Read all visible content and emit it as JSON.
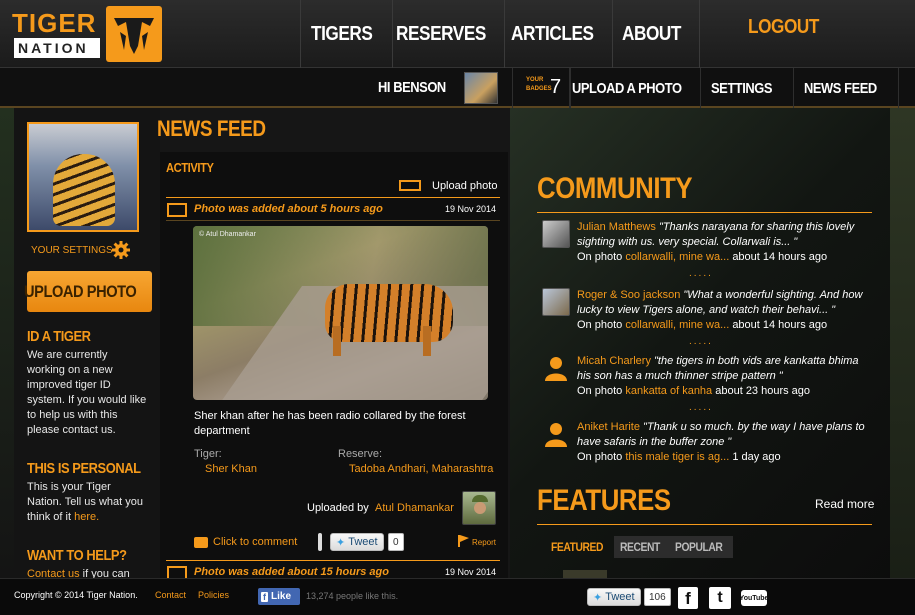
{
  "logo": {
    "line1": "TIGER",
    "line2": "NATION"
  },
  "nav": {
    "tigers": "TIGERS",
    "reserves": "RESERVES",
    "articles": "ARTICLES",
    "about": "ABOUT",
    "logout": "LOGOUT"
  },
  "subnav": {
    "greeting": "HI BENSON",
    "badges_label_1": "YOUR",
    "badges_label_2": "BADGES",
    "badges_count": "7",
    "upload": "UPLOAD A PHOTO",
    "settings": "SETTINGS",
    "news_feed": "NEWS FEED"
  },
  "sidebar": {
    "your_settings": "YOUR SETTINGS",
    "upload_button": "UPLOAD PHOTO",
    "id_title": "ID A TIGER",
    "id_text": "We are currently working on a new improved tiger ID system. If you would like to help us with this please contact us.",
    "personal_title": "THIS IS PERSONAL",
    "personal_text": "This is your Tiger Nation. Tell us what you think of it",
    "personal_link": "here.",
    "help_title": "WANT TO HELP?",
    "help_link": "Contact us",
    "help_text": " if you can"
  },
  "feed": {
    "title": "NEWS FEED",
    "activity": "ACTIVITY",
    "upload_photo": "Upload photo",
    "item1": {
      "headline": "Photo was added about 5 hours ago",
      "date": "19 Nov 2014",
      "photo_credit": "© Atul Dhamankar",
      "caption": "Sher khan after he has been radio collared by the forest department",
      "tiger_label": "Tiger:",
      "tiger_value": "Sher Khan",
      "reserve_label": "Reserve:",
      "reserve_value": "Tadoba Andhari, Maharashtra",
      "uploaded_by": "Uploaded by",
      "uploader": "Atul Dhamankar",
      "comment": "Click to comment",
      "tweet": "Tweet",
      "tweet_count": "0",
      "report": "Report"
    },
    "item2": {
      "headline": "Photo was added about 15 hours ago",
      "date": "19 Nov 2014"
    }
  },
  "community": {
    "title": "COMMUNITY",
    "on_photo": "On photo",
    "entries": [
      {
        "name": "Julian Matthews",
        "quote": "\"Thanks narayana for sharing this lovely sighting with us. very special. Collarwali is... \"",
        "photo": "collarwalli, mine wa...",
        "time": "about 14 hours ago"
      },
      {
        "name": "Roger & Soo jackson",
        "quote": "\"What a wonderful sighting. And how lucky to view Tigers alone, and watch their behavi... \"",
        "photo": "collarwalli, mine wa...",
        "time": "about 14 hours ago"
      },
      {
        "name": "Micah Charlery",
        "quote": "\"the tigers in both vids are kankatta bhima his son has a much thinner stripe pattern \"",
        "photo": "kankatta of kanha",
        "time": "about 23 hours ago"
      },
      {
        "name": "Aniket Harite",
        "quote": "\"Thank u so much. by the way I have plans to have safaris in the buffer zone \"",
        "photo": "this male tiger is ag...",
        "time": "1 day ago"
      }
    ],
    "separator": ".....",
    "features_title": "FEATURES",
    "read_more": "Read more",
    "tabs": [
      "FEATURED",
      "RECENT",
      "POPULAR"
    ]
  },
  "footer": {
    "copyright": "Copyright © 2014 Tiger Nation.",
    "contact": "Contact",
    "policies": "Policies",
    "like": "Like",
    "like_count": "13,274 people like this.",
    "tweet": "Tweet",
    "tweet_count": "106",
    "youtube": "YouTube"
  },
  "colors": {
    "accent": "#f59a1b",
    "background": "#141414",
    "link": "#f59a1b"
  },
  "icons": [
    "tiger-claw-logo-icon",
    "gear-icon",
    "photo-icon",
    "speech-bubble-icon",
    "flag-icon",
    "user-silhouette-icon",
    "facebook-icon",
    "twitter-icon",
    "youtube-icon"
  ]
}
